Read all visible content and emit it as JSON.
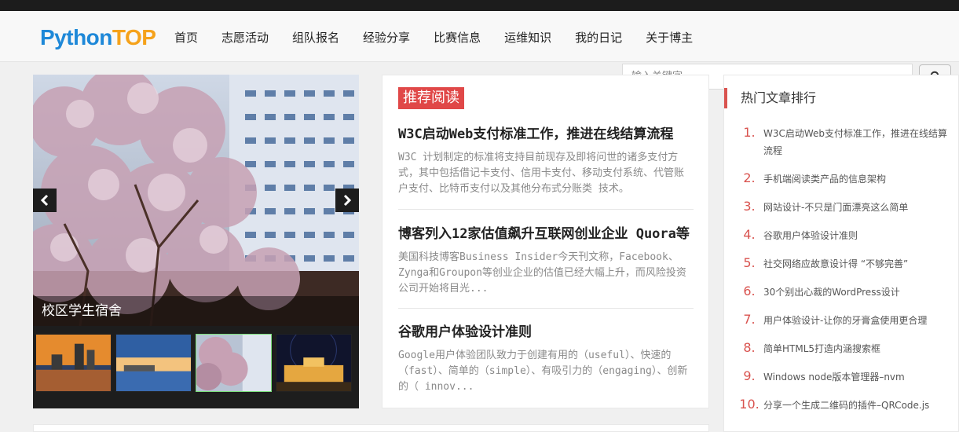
{
  "brand": {
    "part1": "Python",
    "part2": "TOP"
  },
  "nav": [
    "首页",
    "志愿活动",
    "组队报名",
    "经验分享",
    "比赛信息",
    "运维知识",
    "我的日记",
    "关于博主"
  ],
  "search": {
    "placeholder": "输入关键字"
  },
  "slider": {
    "caption": "校区学生宿舍",
    "active_thumb": 3,
    "thumb_count": 4
  },
  "recommend": {
    "tag": "推荐阅读",
    "articles": [
      {
        "title": "W3C启动Web支付标准工作，推进在线结算流程",
        "summary": "W3C 计划制定的标准将支持目前现存及即将问世的诸多支付方式，其中包括借记卡支付、信用卡支付、移动支付系统、代管账户支付、比特币支付以及其他分布式分账类 技术。"
      },
      {
        "title": "博客列入12家估值飙升互联网创业企业 Quora等",
        "summary": "美国科技博客Business Insider今天刊文称，Facebook、Zynga和Groupon等创业企业的估值已经大幅上升，而风险投资公司开始将目光..."
      },
      {
        "title": "谷歌用户体验设计准则",
        "summary": "Google用户体验团队致力于创建有用的（useful）、快速的（fast）、简单的（simple）、有吸引力的（engaging）、创新的（ innov..."
      }
    ]
  },
  "hot": {
    "title": "热门文章排行",
    "items": [
      {
        "num": "1.",
        "text": "W3C启动Web支付标准工作，推进在线结算流程"
      },
      {
        "num": "2.",
        "text": "手机端阅读类产品的信息架构"
      },
      {
        "num": "3.",
        "text": "网站设计-不只是门面漂亮这么简单"
      },
      {
        "num": "4.",
        "text": "谷歌用户体验设计准则"
      },
      {
        "num": "5.",
        "text": "社交网络应故意设计得 “不够完善”"
      },
      {
        "num": "6.",
        "text": "30个别出心裁的WordPress设计"
      },
      {
        "num": "7.",
        "text": "用户体验设计-让你的牙膏盒使用更合理"
      },
      {
        "num": "8.",
        "text": "简单HTML5打造内涵搜索框"
      },
      {
        "num": "9.",
        "text": "Windows node版本管理器–nvm"
      },
      {
        "num": "10.",
        "text": "分享一个生成二维码的插件–QRCode.js"
      }
    ]
  },
  "colors": {
    "brand_blue": "#1e88d8",
    "brand_orange": "#f5a21b",
    "accent_red": "#d9534f"
  }
}
